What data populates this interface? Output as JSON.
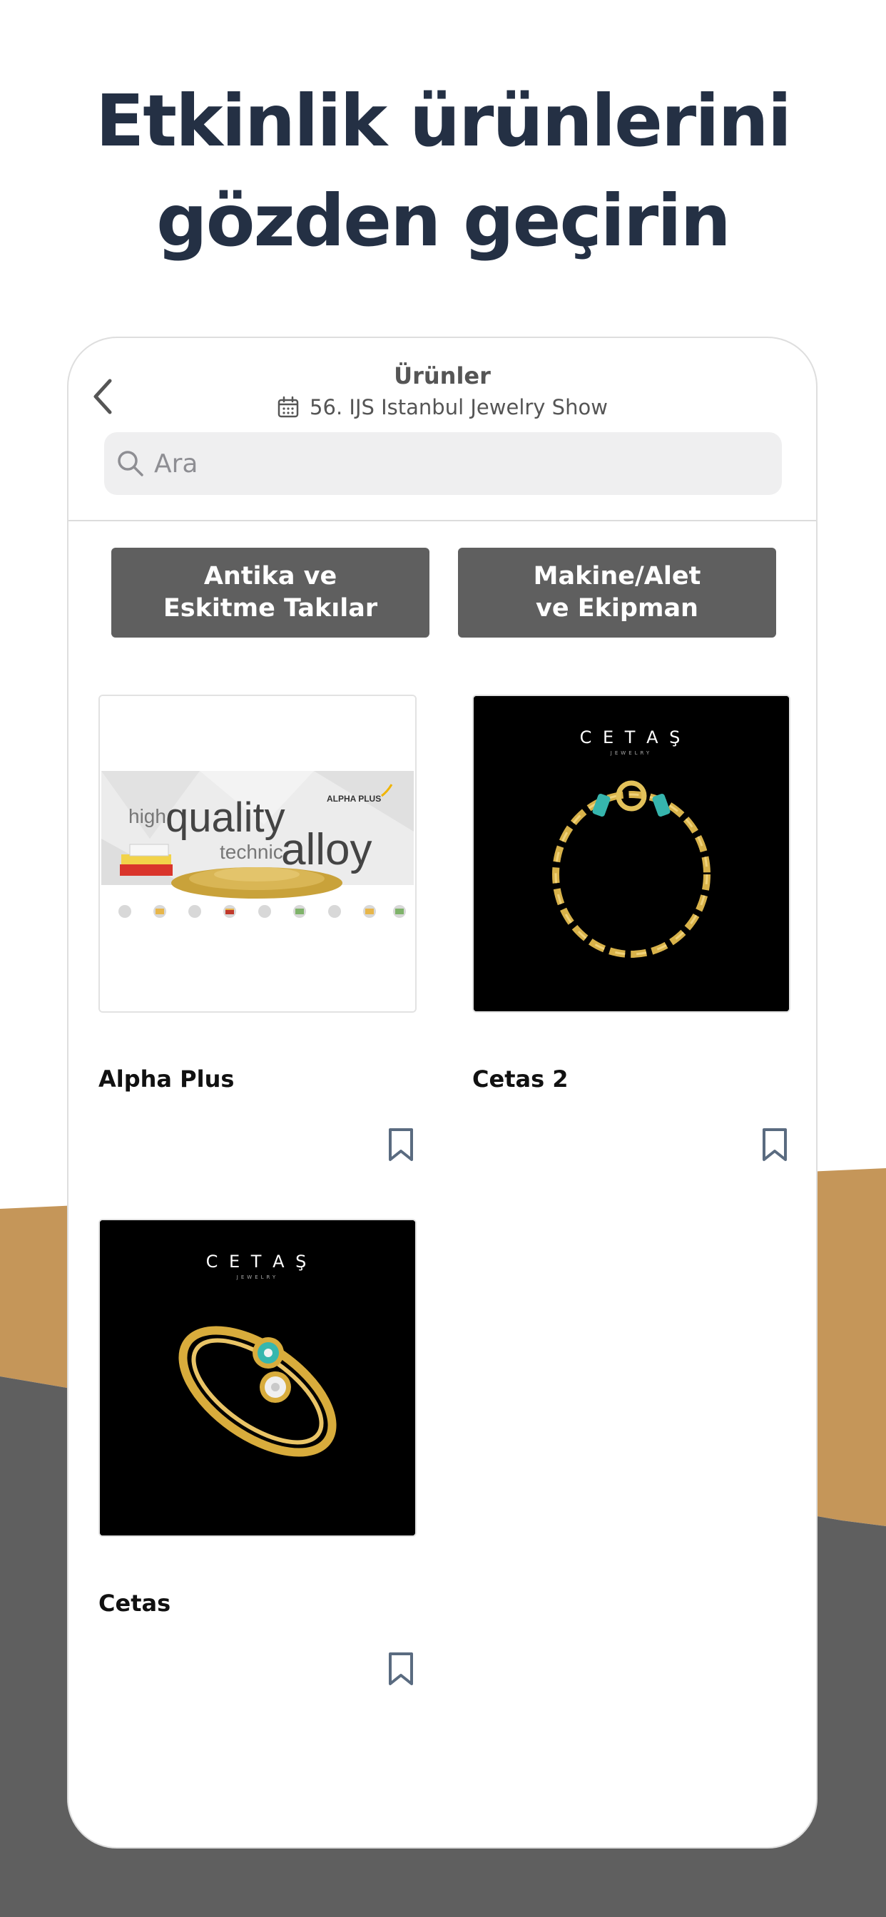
{
  "headline": {
    "line1": "Etkinlik ürünlerini",
    "line2": "gözden geçirin"
  },
  "colors": {
    "headline": "#243044",
    "accent_tan": "#c59659",
    "dark_gray": "#5f5f5f",
    "search_bg": "#efeff0",
    "icon_slate": "#5a6b80"
  },
  "screen": {
    "nav": {
      "back_icon": "chevron-left-icon",
      "title": "Ürünler",
      "event_icon": "calendar-icon",
      "event_name": "56. IJS Istanbul Jewelry Show"
    },
    "search": {
      "icon": "search-icon",
      "placeholder": "Ara"
    },
    "categories": [
      {
        "label": "Antika ve\nEskitme Takılar"
      },
      {
        "label": "Makine/Alet\nve Ekipman"
      }
    ],
    "products": [
      {
        "name": "Alpha Plus",
        "image": {
          "brand": "ALPHA PLUS",
          "w1": "high",
          "w2": "quality",
          "w3": "technic",
          "w4": "alloy"
        },
        "bookmark_icon": "bookmark-icon"
      },
      {
        "name": "Cetas 2",
        "image": {
          "brand": "C E T A Ş",
          "sub": "JEWELRY"
        },
        "bookmark_icon": "bookmark-icon"
      },
      {
        "name": "Cetas",
        "image": {
          "brand": "C E T A Ş",
          "sub": "JEWELRY"
        },
        "bookmark_icon": "bookmark-icon"
      }
    ]
  }
}
